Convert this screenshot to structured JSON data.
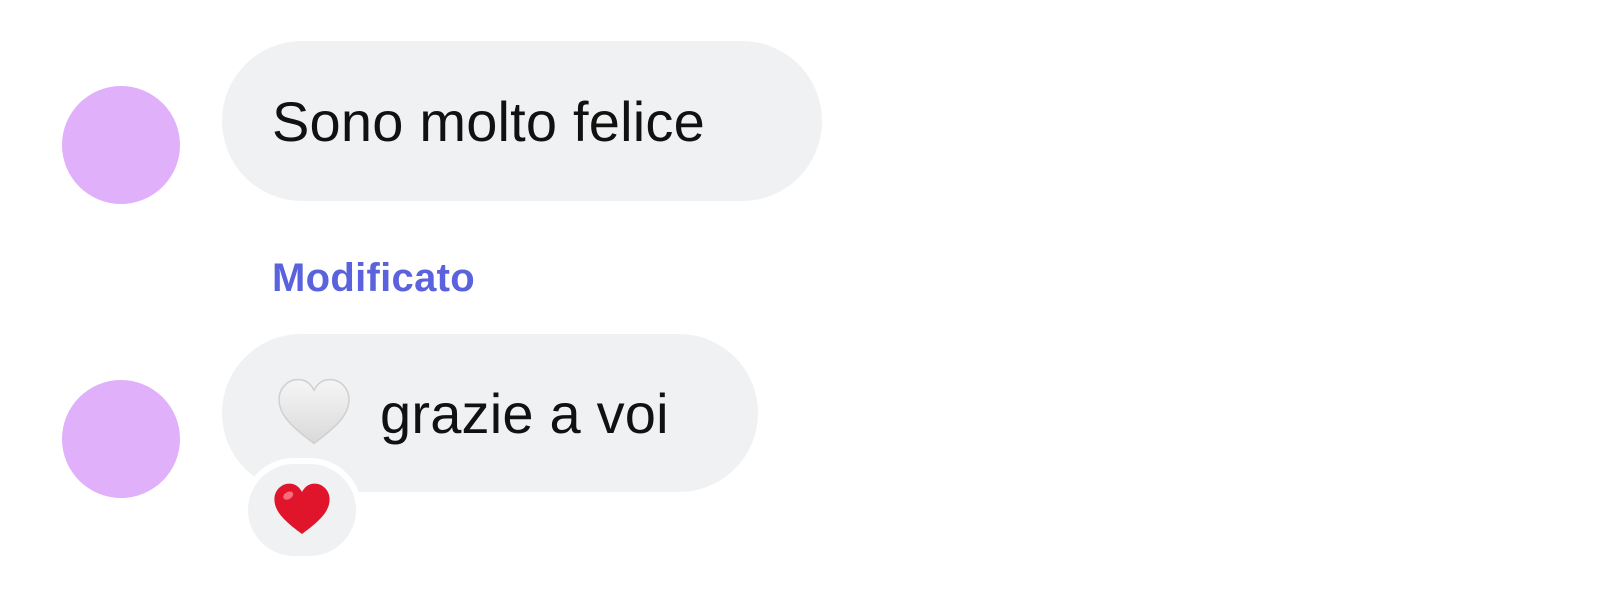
{
  "colors": {
    "avatar": "#e0b0fb",
    "bubble": "#f0f1f3",
    "edited_label": "#5a63dd",
    "text": "#111111",
    "reaction_heart": "#e0142b",
    "white_heart": "#e7e7e7"
  },
  "messages": [
    {
      "text": "Sono molto felice",
      "edited": false
    },
    {
      "edited_label": "Modificato",
      "prefix_icon": "white-heart-icon",
      "text": "grazie a voi",
      "reaction": "red-heart-icon"
    }
  ]
}
